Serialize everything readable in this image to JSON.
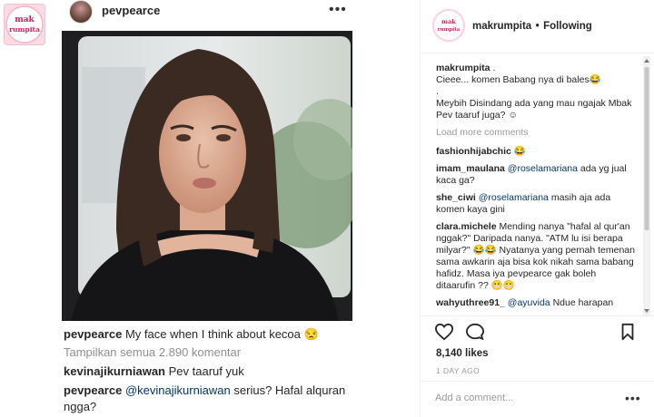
{
  "left_post": {
    "username": "pevpearce",
    "more_glyph": "•••",
    "caption_user": "pevpearce",
    "caption_text": "My face when I think about kecoa 😒",
    "view_all": "Tampilkan semua 2.890 komentar",
    "comment1_user": "kevinajikurniawan",
    "comment1_text": "Pev taaruf yuk",
    "comment2_user": "pevpearce",
    "comment2_mention": "@kevinajikurniawan",
    "comment2_text": "serius? Hafal alquran ngga?"
  },
  "corner_logo": {
    "text1": "mak",
    "text2": "rumpita"
  },
  "right_panel": {
    "username": "makrumpita",
    "separator": "•",
    "follow_status": "Following",
    "caption_user": "makrumpita",
    "caption_line1": ".",
    "caption_line2": "Cieee... komen Babang nya di bales😂",
    "caption_line3": ".",
    "caption_line4": "Meybih Disindang ada yang mau ngajak Mbak Pev taaruf juga? ☺",
    "load_more": "Load more comments",
    "comments": [
      {
        "user": "fashionhijabchic",
        "mention": "",
        "text": "😂"
      },
      {
        "user": "imam_maulana",
        "mention": "@roselamariana",
        "text": "ada yg jual kaca ga?"
      },
      {
        "user": "she_ciwi",
        "mention": "@roselamariana",
        "text": "masih aja ada komen kaya gini"
      },
      {
        "user": "clara.michele",
        "mention": "",
        "text": "Mending nanya \"hafal al qur'an nggak?\" Daripada nanya. \"ATM lu isi berapa milyar?\" 😂😂 Nyatanya yang pernah temenan sama awkarin aja bisa kok nikah sama babang hafidz. Masa iya pevpearce gak boleh ditaarufin ?? 😬😬"
      },
      {
        "user": "wahyuthree91_",
        "mention": "@ayuvida",
        "text": "Ndue harapan"
      }
    ],
    "likes": "8,140 likes",
    "date": "1 DAY AGO",
    "add_comment_placeholder": "Add a comment...",
    "more_glyph": "•••"
  }
}
